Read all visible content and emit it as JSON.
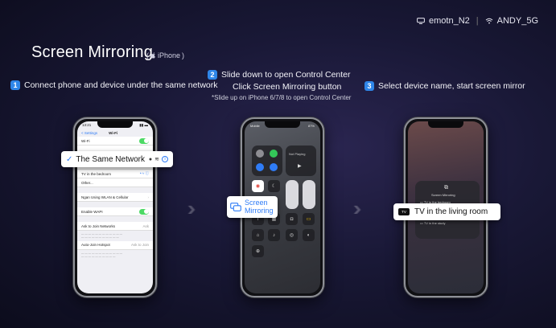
{
  "status": {
    "device_name": "emotn_N2",
    "wifi_name": "ANDY_5G"
  },
  "header": {
    "title": "Screen Mirroring",
    "subtitle": "iPhone"
  },
  "steps": [
    {
      "number": "1",
      "text": "Connect phone and device under the same network"
    },
    {
      "number": "2",
      "text": "Slide down to open Control Center",
      "text2": "Click Screen Mirroring button",
      "note": "*Slide up on iPhone 6/7/8 to open Control Center"
    },
    {
      "number": "3",
      "text": "Select device name, start screen mirror"
    }
  ],
  "phone1": {
    "time": "13:21",
    "back": "< Settings",
    "nav_title": "Wi-Fi",
    "wifi_label": "Wi-Fi",
    "section_header": "MY NETWORKS",
    "networks": [
      "Dongle2019",
      "TV in the bedroom",
      "Other..."
    ],
    "rows": [
      "Ngan Using WLAN & Cellular",
      "Enable WAPI",
      "Ask to Join Networks",
      "Auto-Join Hotspot"
    ],
    "ask_value": "Ask",
    "hotspot_value": "Ask to Join",
    "callout": "The Same Network"
  },
  "phone2": {
    "carrier": "Mobile",
    "battery": "87%",
    "now_playing": "Not Playing",
    "callout_line1": "Screen",
    "callout_line2": "Mirroring"
  },
  "phone3": {
    "panel_title": "Screen Mirroring",
    "devices": [
      "TV in the bedroom",
      "TV in the study"
    ],
    "callout": "TV in the living room",
    "tv_badge": "TV"
  },
  "colors": {
    "accent": "#2f86e8",
    "background": "#191836"
  }
}
